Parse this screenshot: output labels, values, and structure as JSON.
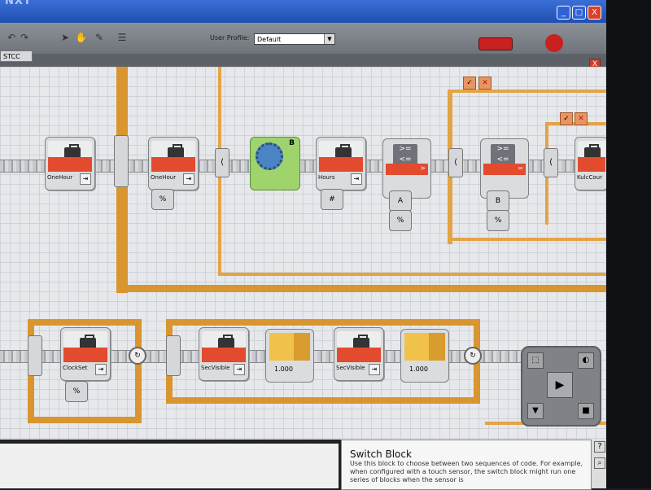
{
  "window": {
    "title": "NXT",
    "minimize": "_",
    "maximize": "□",
    "close": "X"
  },
  "toolbar": {
    "user_profile_label": "User Profile:",
    "user_profile_value": "Default",
    "dropdown_arrow": "▼"
  },
  "tab": {
    "name": "STCC",
    "close": "X"
  },
  "blocks": {
    "b1": "OneHour",
    "b2": "OneHour",
    "b3": "Hours",
    "b4": "KulcCour",
    "b5": "ClockSet",
    "b6": "SecVisible",
    "b7": "SecVisible"
  },
  "motor_port": "B",
  "compare": {
    "c1_port": "A",
    "c2_port": "B",
    "c1_op": ">",
    "c2_op": "="
  },
  "waits": {
    "w1": "1.000",
    "w2": "1.000"
  },
  "help": {
    "title": "Switch Block",
    "body": "Use this block to choose between two sequences of code. For example, when configured with a touch sensor, the switch block might run one series of blocks when the sensor is"
  },
  "icons": [
    "case-icon",
    "gear-icon",
    "hourglass-icon",
    "loop-icon",
    "check-icon",
    "x-icon",
    "help-icon",
    "magnify-icon",
    "controller-icon"
  ]
}
